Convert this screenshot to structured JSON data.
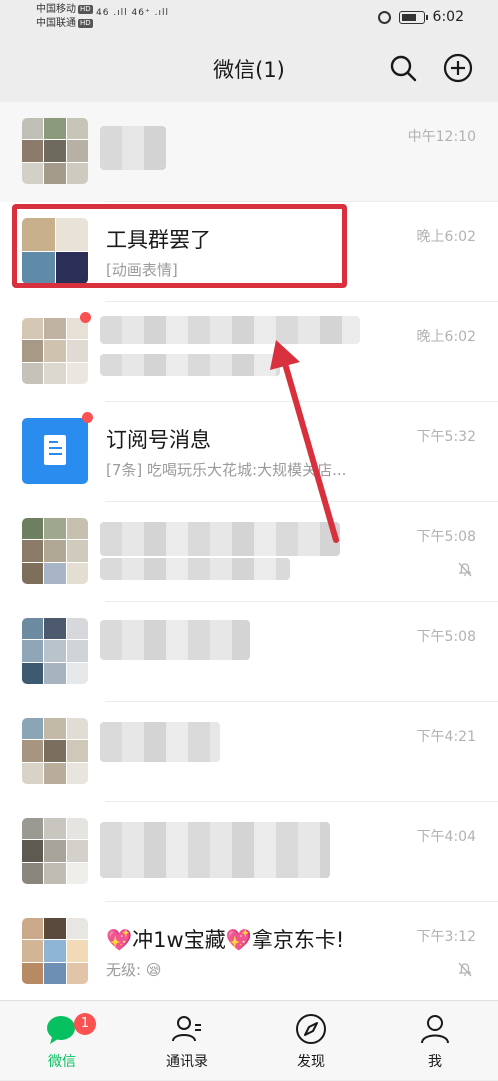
{
  "status_bar": {
    "carrier1": "中国移动",
    "carrier2": "中国联通",
    "hd": "HD",
    "signals": "46 .ıll 46⁺ .ıll",
    "time": "6:02",
    "battery_level": 0.75
  },
  "nav": {
    "title": "微信(1)"
  },
  "chats": [
    {
      "name": "",
      "preview": "",
      "time": "中午12:10",
      "muted": false
    },
    {
      "name": "工具群罢了",
      "preview": "[动画表情]",
      "time": "晚上6:02",
      "muted": false
    },
    {
      "name": "",
      "preview": "",
      "time": "晚上6:02",
      "muted": false
    },
    {
      "name": "订阅号消息",
      "preview": "[7条] 吃喝玩乐大花城:大规模关店...",
      "time": "下午5:32",
      "muted": false
    },
    {
      "name": "",
      "preview": "",
      "time": "下午5:08",
      "muted": true
    },
    {
      "name": "",
      "preview": "",
      "time": "下午5:08",
      "muted": false
    },
    {
      "name": "",
      "preview": "",
      "time": "下午4:21",
      "muted": false
    },
    {
      "name": "",
      "preview": "",
      "time": "下午4:04",
      "muted": false
    },
    {
      "name_emoji_left": "💖",
      "name_main": "冲1w宝藏",
      "name_emoji_mid": "💖",
      "name_tail": "拿京东卡!",
      "preview": "无级:",
      "preview_emoji": "😪",
      "time": "下午3:12",
      "muted": true
    }
  ],
  "tabs": [
    {
      "label": "微信",
      "badge": "1",
      "icon": "chat-bubble-icon",
      "active": true
    },
    {
      "label": "通讯录",
      "icon": "contacts-icon",
      "active": false
    },
    {
      "label": "发现",
      "icon": "compass-icon",
      "active": false
    },
    {
      "label": "我",
      "icon": "person-icon",
      "active": false
    }
  ],
  "colors": {
    "accent": "#07c160",
    "badge": "#fa5151",
    "highlight": "#d9303d",
    "subscription": "#2b8cf0"
  }
}
